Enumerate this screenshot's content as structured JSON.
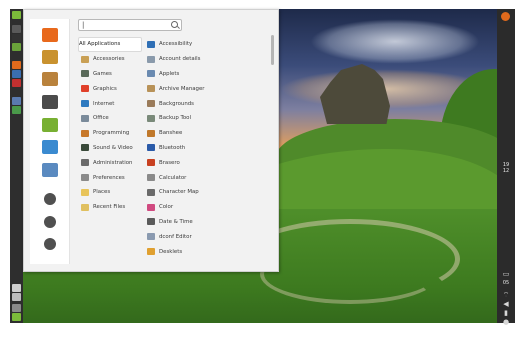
{
  "desktop": {
    "wallpaper": "grassy hill landscape"
  },
  "left_panel": {
    "icons": [
      {
        "name": "menu-icon",
        "color": "#7cbb3a"
      },
      {
        "name": "show-desktop-icon",
        "color": "#5a5a5a"
      },
      {
        "name": "terminal-icon",
        "color": "#333333"
      },
      {
        "name": "files-icon",
        "color": "#6aa33a"
      },
      {
        "name": "firefox-icon",
        "color": "#e06a1c"
      },
      {
        "name": "thunderbird-icon",
        "color": "#3a6fb0"
      },
      {
        "name": "software-icon",
        "color": "#c03030"
      },
      {
        "name": "window-list-1-icon",
        "color": "#5a7bb0"
      },
      {
        "name": "window-list-2-icon",
        "color": "#4a9a4a"
      },
      {
        "name": "network-icon",
        "color": "#cfcfcf"
      },
      {
        "name": "workspace-switcher-icon",
        "color": "#bdbdbd"
      },
      {
        "name": "trash-icon",
        "color": "#8a8a8a"
      },
      {
        "name": "mint-logo-icon",
        "color": "#7cbb3a"
      }
    ]
  },
  "right_panel": {
    "clock": {
      "hour": "19",
      "minute": "12"
    },
    "time2": "05"
  },
  "menu": {
    "search": {
      "value": "",
      "placeholder": ""
    },
    "favorites": [
      {
        "name": "firefox-icon",
        "color": "#e8691c"
      },
      {
        "name": "software-manager-icon",
        "color": "#c9922f"
      },
      {
        "name": "package-icon",
        "color": "#b9823c"
      },
      {
        "name": "settings-icon",
        "color": "#4b4b4b"
      },
      {
        "name": "folder-icon",
        "color": "#78b032"
      },
      {
        "name": "color-app-icon",
        "color": "#3a8ad0"
      },
      {
        "name": "network-app-icon",
        "color": "#5a8ac0"
      },
      {
        "name": "lock-icon",
        "color": "#505050"
      },
      {
        "name": "logout-icon",
        "color": "#505050"
      },
      {
        "name": "shutdown-icon",
        "color": "#505050"
      }
    ],
    "categories": [
      {
        "label": "All Applications",
        "icon": "all-apps-icon",
        "color": "#ffffff",
        "selected": true
      },
      {
        "label": "Accessories",
        "icon": "accessories-icon",
        "color": "#c9a055"
      },
      {
        "label": "Games",
        "icon": "games-icon",
        "color": "#5a6a5a"
      },
      {
        "label": "Graphics",
        "icon": "graphics-icon",
        "color": "#e0402a"
      },
      {
        "label": "Internet",
        "icon": "internet-icon",
        "color": "#2e7ac0"
      },
      {
        "label": "Office",
        "icon": "office-icon",
        "color": "#7a8a9a"
      },
      {
        "label": "Programming",
        "icon": "programming-icon",
        "color": "#c7782a"
      },
      {
        "label": "Sound & Video",
        "icon": "sound-video-icon",
        "color": "#3a4a3a"
      },
      {
        "label": "Administration",
        "icon": "administration-icon",
        "color": "#6a6a6a"
      },
      {
        "label": "Preferences",
        "icon": "preferences-icon",
        "color": "#8a8a8a"
      },
      {
        "label": "Places",
        "icon": "places-icon",
        "color": "#e8c45a"
      },
      {
        "label": "Recent Files",
        "icon": "recent-files-icon",
        "color": "#e0c060"
      }
    ],
    "apps": [
      {
        "label": "Accessibility",
        "icon": "accessibility-icon",
        "color": "#2f6fb5"
      },
      {
        "label": "Account details",
        "icon": "account-details-icon",
        "color": "#8a9aab"
      },
      {
        "label": "Applets",
        "icon": "applets-icon",
        "color": "#6a8ab0"
      },
      {
        "label": "Archive Manager",
        "icon": "archive-manager-icon",
        "color": "#b89258"
      },
      {
        "label": "Backgrounds",
        "icon": "backgrounds-icon",
        "color": "#9a7b5a"
      },
      {
        "label": "Backup Tool",
        "icon": "backup-tool-icon",
        "color": "#7a8a7a"
      },
      {
        "label": "Banshee",
        "icon": "banshee-icon",
        "color": "#c0782a"
      },
      {
        "label": "Bluetooth",
        "icon": "bluetooth-icon",
        "color": "#2a5aa8"
      },
      {
        "label": "Brasero",
        "icon": "brasero-icon",
        "color": "#c84020"
      },
      {
        "label": "Calculator",
        "icon": "calculator-icon",
        "color": "#8a8a8a"
      },
      {
        "label": "Character Map",
        "icon": "character-map-icon",
        "color": "#6a6a6a"
      },
      {
        "label": "Color",
        "icon": "color-icon",
        "color": "#d04a80"
      },
      {
        "label": "Date & Time",
        "icon": "date-time-icon",
        "color": "#5a5a5a"
      },
      {
        "label": "dconf Editor",
        "icon": "dconf-editor-icon",
        "color": "#8a9ab0"
      },
      {
        "label": "Desklets",
        "icon": "desklets-icon",
        "color": "#e0a030"
      }
    ]
  }
}
